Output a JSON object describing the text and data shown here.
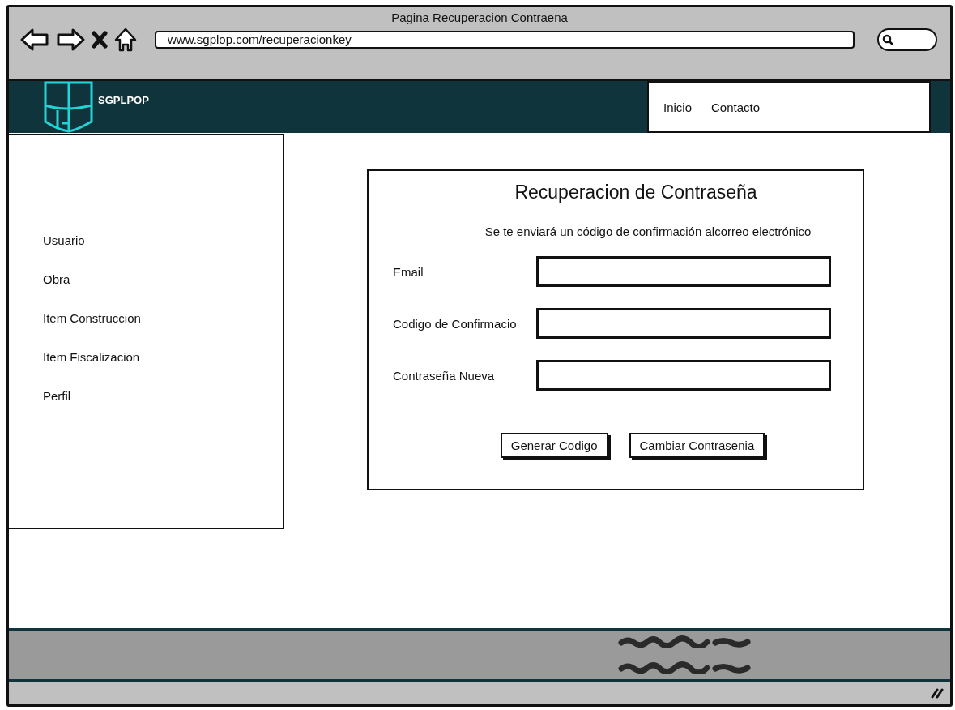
{
  "browser": {
    "title": "Pagina Recuperacion Contraena",
    "url": "www.sgplop.com/recuperacionkey"
  },
  "header": {
    "logo_text": "SGPLPOP",
    "nav": [
      {
        "label": "Inicio"
      },
      {
        "label": "Contacto"
      }
    ]
  },
  "sidebar": {
    "items": [
      "Usuario",
      "Obra",
      "Item Construccion",
      "Item Fiscalizacion",
      "Perfil"
    ]
  },
  "form": {
    "title": "Recuperacion de Contraseña",
    "subtitle": "Se te enviará un código de confirmación alcorreo electrónico",
    "fields": [
      {
        "label": "Email"
      },
      {
        "label": "Codigo de Confirmacio"
      },
      {
        "label": "Contraseña Nueva"
      }
    ],
    "buttons": [
      "Generar Codigo",
      "Cambiar Contrasenia"
    ]
  }
}
